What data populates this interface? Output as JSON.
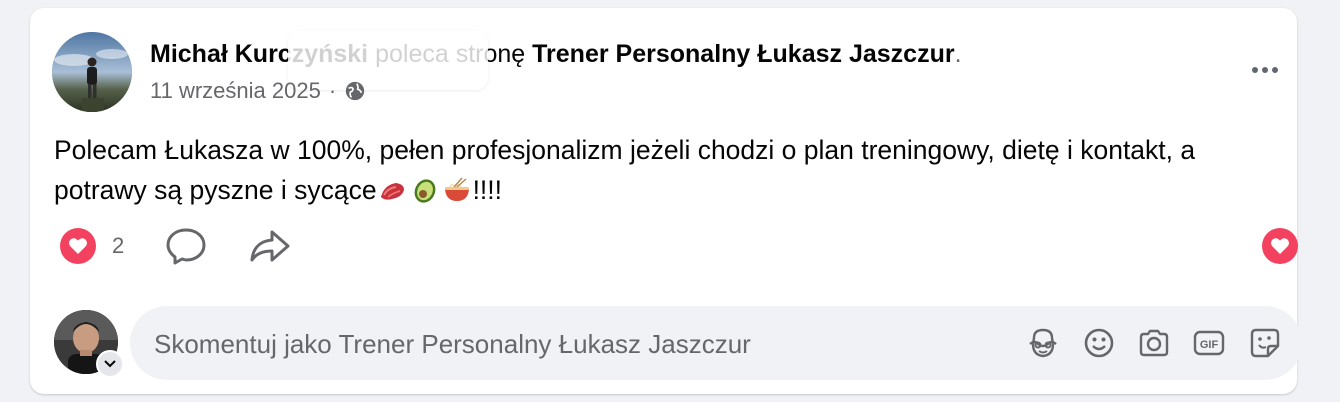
{
  "post": {
    "author": "Michał Kurczyński",
    "verb": "poleca stronę",
    "page": "Trener Personalny Łukasz Jaszczur",
    "trailing_dot": ".",
    "date": "11 września 2025",
    "separator": "·",
    "text": "Polecam Łukasza w 100%, pełen profesjonalizm jeżeli chodzi o plan treningowy, dietę i kontakt, a  potrawy są pyszne i sycące",
    "text_tail": "!!!!",
    "emojis": [
      "meat-emoji",
      "avocado-emoji",
      "noodle-bowl-emoji"
    ]
  },
  "reactions": {
    "count": "2",
    "type": "love"
  },
  "comment_box": {
    "placeholder": "Skomentuj jako Trener Personalny Łukasz Jaszczur",
    "value": "",
    "tools": [
      "avatar-sticker-icon",
      "emoji-icon",
      "camera-icon",
      "gif-icon",
      "sticker-icon"
    ]
  },
  "colors": {
    "love_red": "#f3425f",
    "secondary_text": "#65676b",
    "card_bg": "#ffffff",
    "page_bg": "#f0f2f5"
  }
}
